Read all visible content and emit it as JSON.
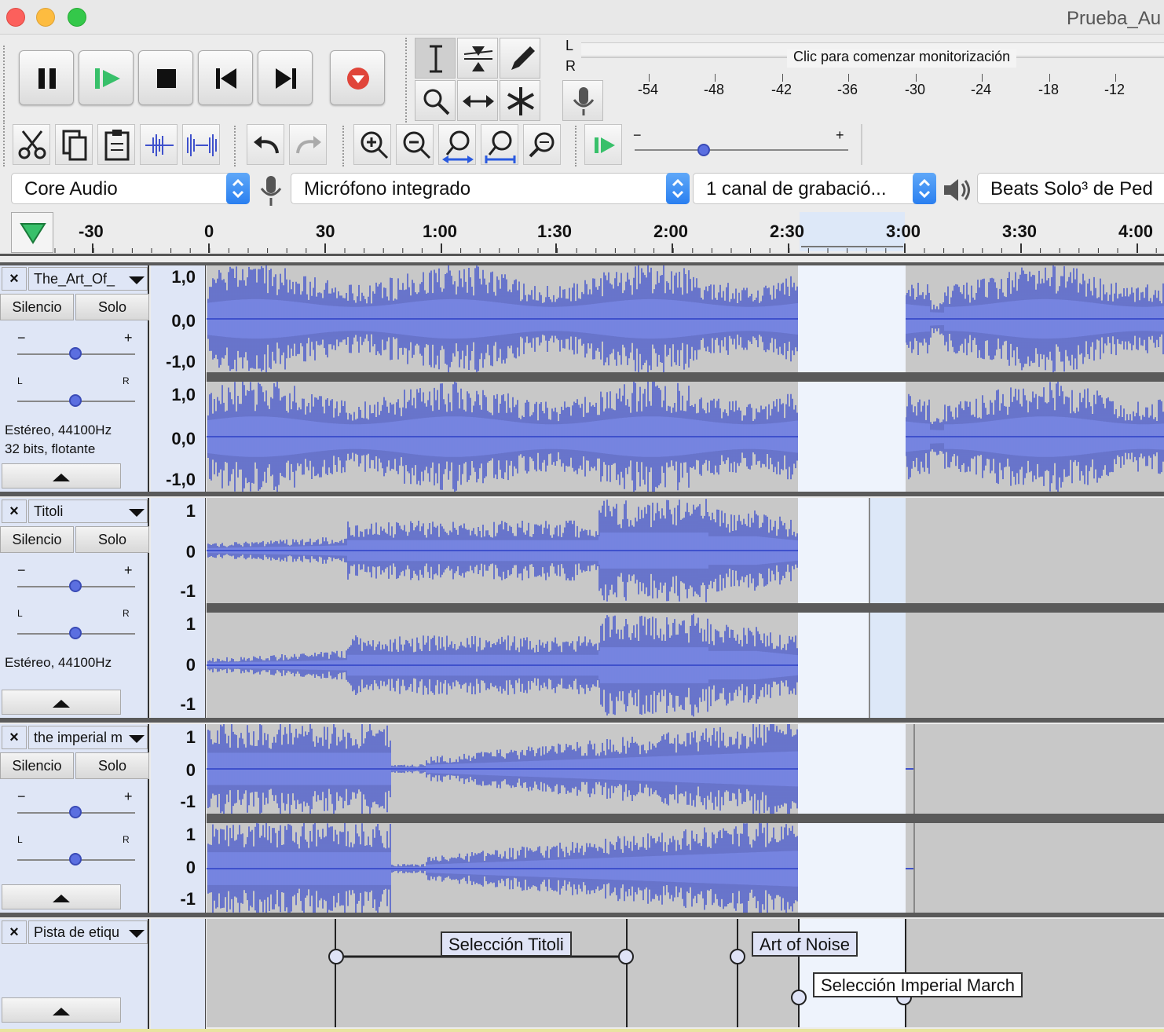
{
  "window": {
    "title": "Prueba_Au"
  },
  "meter": {
    "left_label": "L",
    "right_label": "R",
    "monitor_text": "Clic para comenzar monitorización",
    "ticks": [
      "-54",
      "-48",
      "-42",
      "-36",
      "-30",
      "-24",
      "-18",
      "-12"
    ]
  },
  "play_speed": {
    "minus": "−",
    "plus": "+"
  },
  "devices": {
    "host": "Core Audio",
    "input": "Micrófono integrado",
    "channels": "1 canal de grabació...",
    "output": "Beats Solo³ de Ped"
  },
  "ruler": {
    "labels": [
      "-30",
      "0",
      "30",
      "1:00",
      "1:30",
      "2:00",
      "2:30",
      "3:00",
      "3:30",
      "4:00"
    ]
  },
  "tracks": [
    {
      "name": "The_Art_Of_",
      "mute": "Silencio",
      "solo": "Solo",
      "gain_minus": "−",
      "gain_plus": "+",
      "pan_left": "L",
      "pan_right": "R",
      "info_line1": "Estéreo, 44100Hz",
      "info_line2": "32 bits, flotante",
      "scale_top": "1,0",
      "scale_mid": "0,0",
      "scale_bot": "-1,0"
    },
    {
      "name": "Titoli",
      "mute": "Silencio",
      "solo": "Solo",
      "gain_minus": "−",
      "gain_plus": "+",
      "pan_left": "L",
      "pan_right": "R",
      "info_line1": "Estéreo, 44100Hz",
      "scale_top": "1",
      "scale_mid": "0",
      "scale_bot": "-1"
    },
    {
      "name": "the imperial m",
      "mute": "Silencio",
      "solo": "Solo",
      "gain_minus": "−",
      "gain_plus": "+",
      "pan_left": "L",
      "pan_right": "R",
      "scale_top": "1",
      "scale_mid": "0",
      "scale_bot": "-1"
    }
  ],
  "label_track": {
    "name": "Pista de etiqu",
    "labels": [
      "Selección Titoli",
      "Art of Noise",
      "Selección Imperial March"
    ]
  },
  "colors": {
    "waveform": "#3f51cc",
    "selection": "#dde8f8",
    "track_panel": "#dfe6f6",
    "record": "#e0453a",
    "play": "#38c06a"
  }
}
